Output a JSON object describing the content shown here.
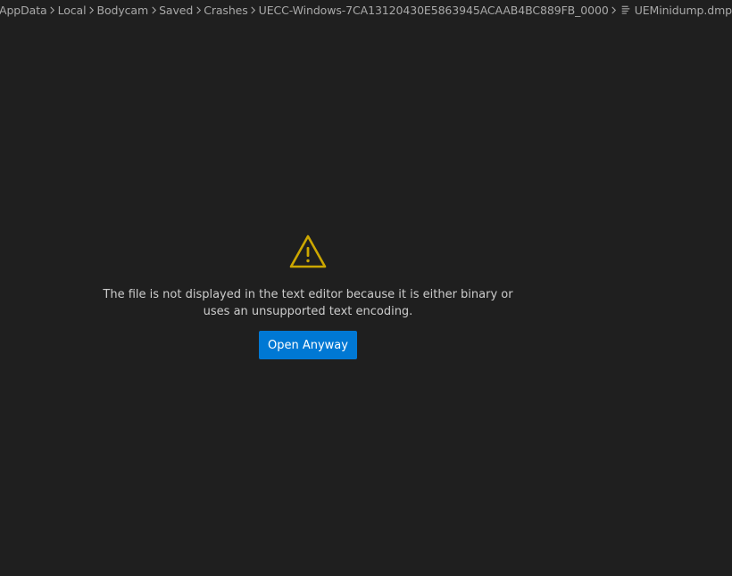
{
  "breadcrumbs": [
    {
      "label": "AppData"
    },
    {
      "label": "Local"
    },
    {
      "label": "Bodycam"
    },
    {
      "label": "Saved"
    },
    {
      "label": "Crashes"
    },
    {
      "label": "UECC-Windows-7CA13120430E5863945ACAAB4BC889FB_0000"
    }
  ],
  "file": {
    "name": "UEMinidump.dmp",
    "icon": "file-lines-icon"
  },
  "warning": {
    "icon": "warning-icon",
    "color": "#cca700",
    "message": "The file is not displayed in the text editor because it is either binary or uses an unsupported text encoding."
  },
  "actions": {
    "open_anyway_label": "Open Anyway",
    "button_color": "#0078d4"
  }
}
